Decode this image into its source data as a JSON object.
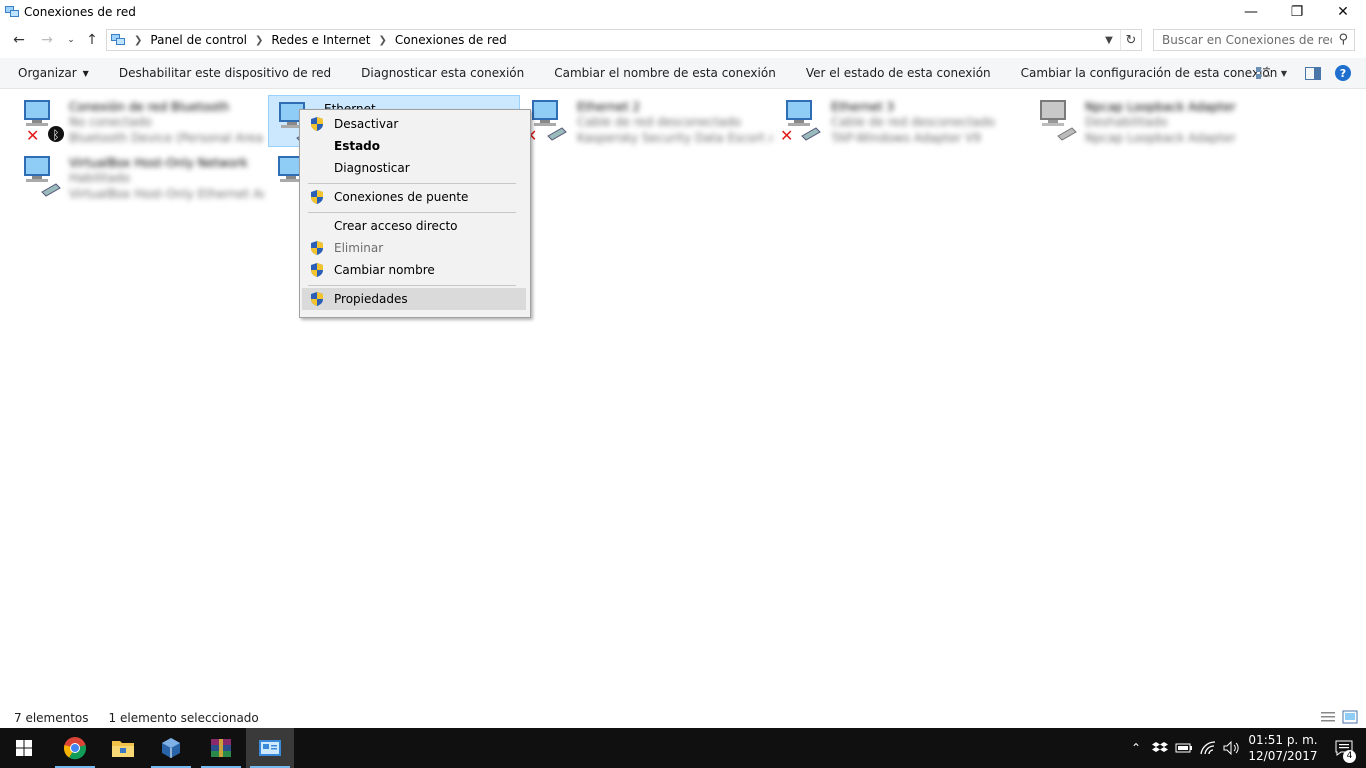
{
  "window": {
    "title": "Conexiones de red",
    "controls": {
      "minimize": "—",
      "restore": "❐",
      "close": "✕"
    }
  },
  "address": {
    "breadcrumb": [
      "Panel de control",
      "Redes e Internet",
      "Conexiones de red"
    ],
    "search_placeholder": "Buscar en Conexiones de red"
  },
  "commandbar": {
    "items": [
      "Organizar",
      "Deshabilitar este dispositivo de red",
      "Diagnosticar esta conexión",
      "Cambiar el nombre de esta conexión",
      "Ver el estado de esta conexión",
      "Cambiar la configuración de esta conexión"
    ]
  },
  "connections": [
    {
      "name": "Conexión de red Bluetooth",
      "status": "No conectado",
      "device": "Bluetooth Device (Personal Area Network)",
      "state_icon": "red-x-icon",
      "badge": "bluetooth-icon"
    },
    {
      "name": "Ethernet",
      "status": "",
      "device": "",
      "selected": true
    },
    {
      "name": "Ethernet 2",
      "status": "Cable de red desconectado",
      "device": "Kaspersky Security Data Escort Adapter",
      "state_icon": "red-x-icon"
    },
    {
      "name": "Ethernet 3",
      "status": "Cable de red desconectado",
      "device": "TAP-Windows Adapter V9",
      "state_icon": "red-x-icon"
    },
    {
      "name": "Npcap Loopback Adapter",
      "status": "Deshabilitado",
      "device": "Npcap Loopback Adapter"
    },
    {
      "name": "VirtualBox Host-Only Network",
      "status": "Habilitado",
      "device": "VirtualBox Host-Only Ethernet Adapter"
    },
    {
      "name": "",
      "status": "",
      "device": ""
    }
  ],
  "context_menu": {
    "items": [
      {
        "label": "Desactivar",
        "shield": true
      },
      {
        "label": "Estado",
        "bold": true
      },
      {
        "label": "Diagnosticar"
      },
      {
        "label": "Conexiones de puente",
        "shield": true
      },
      {
        "label": "Crear acceso directo"
      },
      {
        "label": "Eliminar",
        "shield": true,
        "disabled": true
      },
      {
        "label": "Cambiar nombre",
        "shield": true
      },
      {
        "label": "Propiedades",
        "shield": true,
        "highlighted": true
      }
    ]
  },
  "statusbar": {
    "count": "7 elementos",
    "selection": "1 elemento seleccionado"
  },
  "taskbar": {
    "time": "01:51 p. m.",
    "date": "12/07/2017",
    "notifications": "4"
  },
  "colors": {
    "selection": "#cce8ff",
    "taskbar": "#101010",
    "accent": "#76b9ed",
    "help": "#1f6fcf"
  }
}
